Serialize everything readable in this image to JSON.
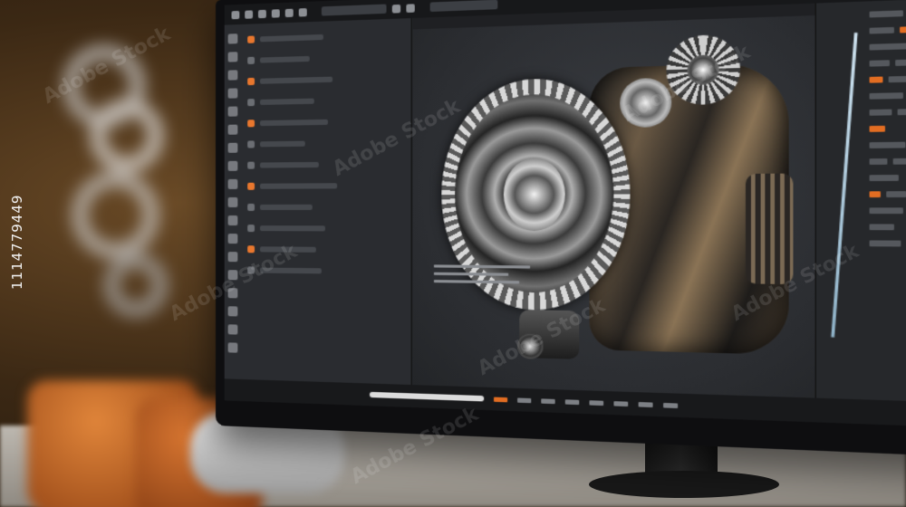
{
  "scene": {
    "description_colors": {
      "wall": "#3b2814",
      "accent": "#e26d22",
      "screen_bg": "#222427"
    }
  },
  "cad_app": {
    "left_panel": {
      "rows": [
        {
          "kind": "orange"
        },
        {
          "kind": "grey"
        },
        {
          "kind": "orange"
        },
        {
          "kind": "grey"
        },
        {
          "kind": "orange"
        },
        {
          "kind": "grey"
        },
        {
          "kind": "grey"
        },
        {
          "kind": "orange"
        },
        {
          "kind": "grey"
        },
        {
          "kind": "grey"
        },
        {
          "kind": "orange"
        },
        {
          "kind": "grey"
        }
      ]
    },
    "viewport": {
      "object": "gear-assembly-3d-model"
    },
    "icons": [
      "toolbar-icon",
      "tool-icon"
    ]
  },
  "overlay": {
    "watermark_text": "Adobe Stock",
    "side_id": "1114779449"
  }
}
